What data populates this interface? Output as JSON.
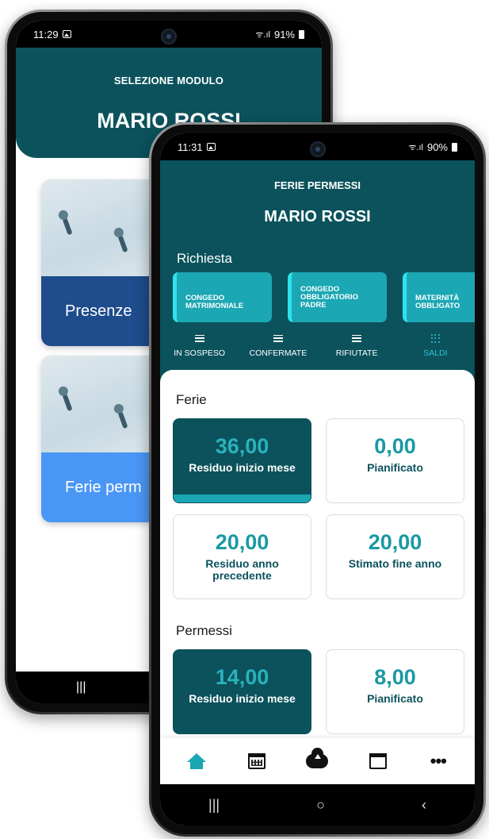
{
  "back_phone": {
    "status": {
      "time": "11:29",
      "battery": "91%"
    },
    "header": {
      "subtitle": "SELEZIONE MODULO",
      "name": "MARIO ROSSI"
    },
    "modules": [
      {
        "label": "Presenze",
        "color": "#1e4c8c"
      },
      {
        "label": "Ferie perm",
        "color": "#4a96f5"
      }
    ],
    "nav_recent": "|||"
  },
  "front_phone": {
    "status": {
      "time": "11:31",
      "battery": "90%"
    },
    "header": {
      "subtitle": "FERIE PERMESSI",
      "name": "MARIO ROSSI",
      "section": "Richiesta"
    },
    "chips": [
      {
        "label": "CONGEDO MATRIMONIALE"
      },
      {
        "label": "CONGEDO OBBLIGATORIO PADRE"
      },
      {
        "label": "MATERNITÀ OBBLIGATO"
      }
    ],
    "tabs": [
      {
        "label": "IN SOSPESO",
        "icon": "list-icon"
      },
      {
        "label": "CONFERMATE",
        "icon": "list-icon"
      },
      {
        "label": "RIFIUTATE",
        "icon": "list-icon"
      },
      {
        "label": "SALDI",
        "icon": "grid-icon",
        "active": true
      }
    ],
    "ferie": {
      "title": "Ferie",
      "tiles": [
        {
          "value": "36,00",
          "label": "Residuo inizio mese",
          "highlighted": true
        },
        {
          "value": "0,00",
          "label": "Pianificato"
        },
        {
          "value": "20,00",
          "label": "Residuo anno precedente"
        },
        {
          "value": "20,00",
          "label": "Stimato fine anno"
        }
      ]
    },
    "permessi": {
      "title": "Permessi",
      "tiles": [
        {
          "value": "14,00",
          "label": "Residuo inizio mese",
          "highlighted": true
        },
        {
          "value": "8,00",
          "label": "Pianificato"
        }
      ]
    },
    "bottom_nav": [
      "home-icon",
      "calendar-grid-icon",
      "cloud-upload-icon",
      "calendar-icon",
      "more-icon"
    ],
    "sys_nav": {
      "recent": "|||",
      "home": "○",
      "back": "‹"
    },
    "colors": {
      "primary": "#0b525c",
      "accent": "#1aa6b2",
      "chip": "#1ca7b4"
    }
  }
}
